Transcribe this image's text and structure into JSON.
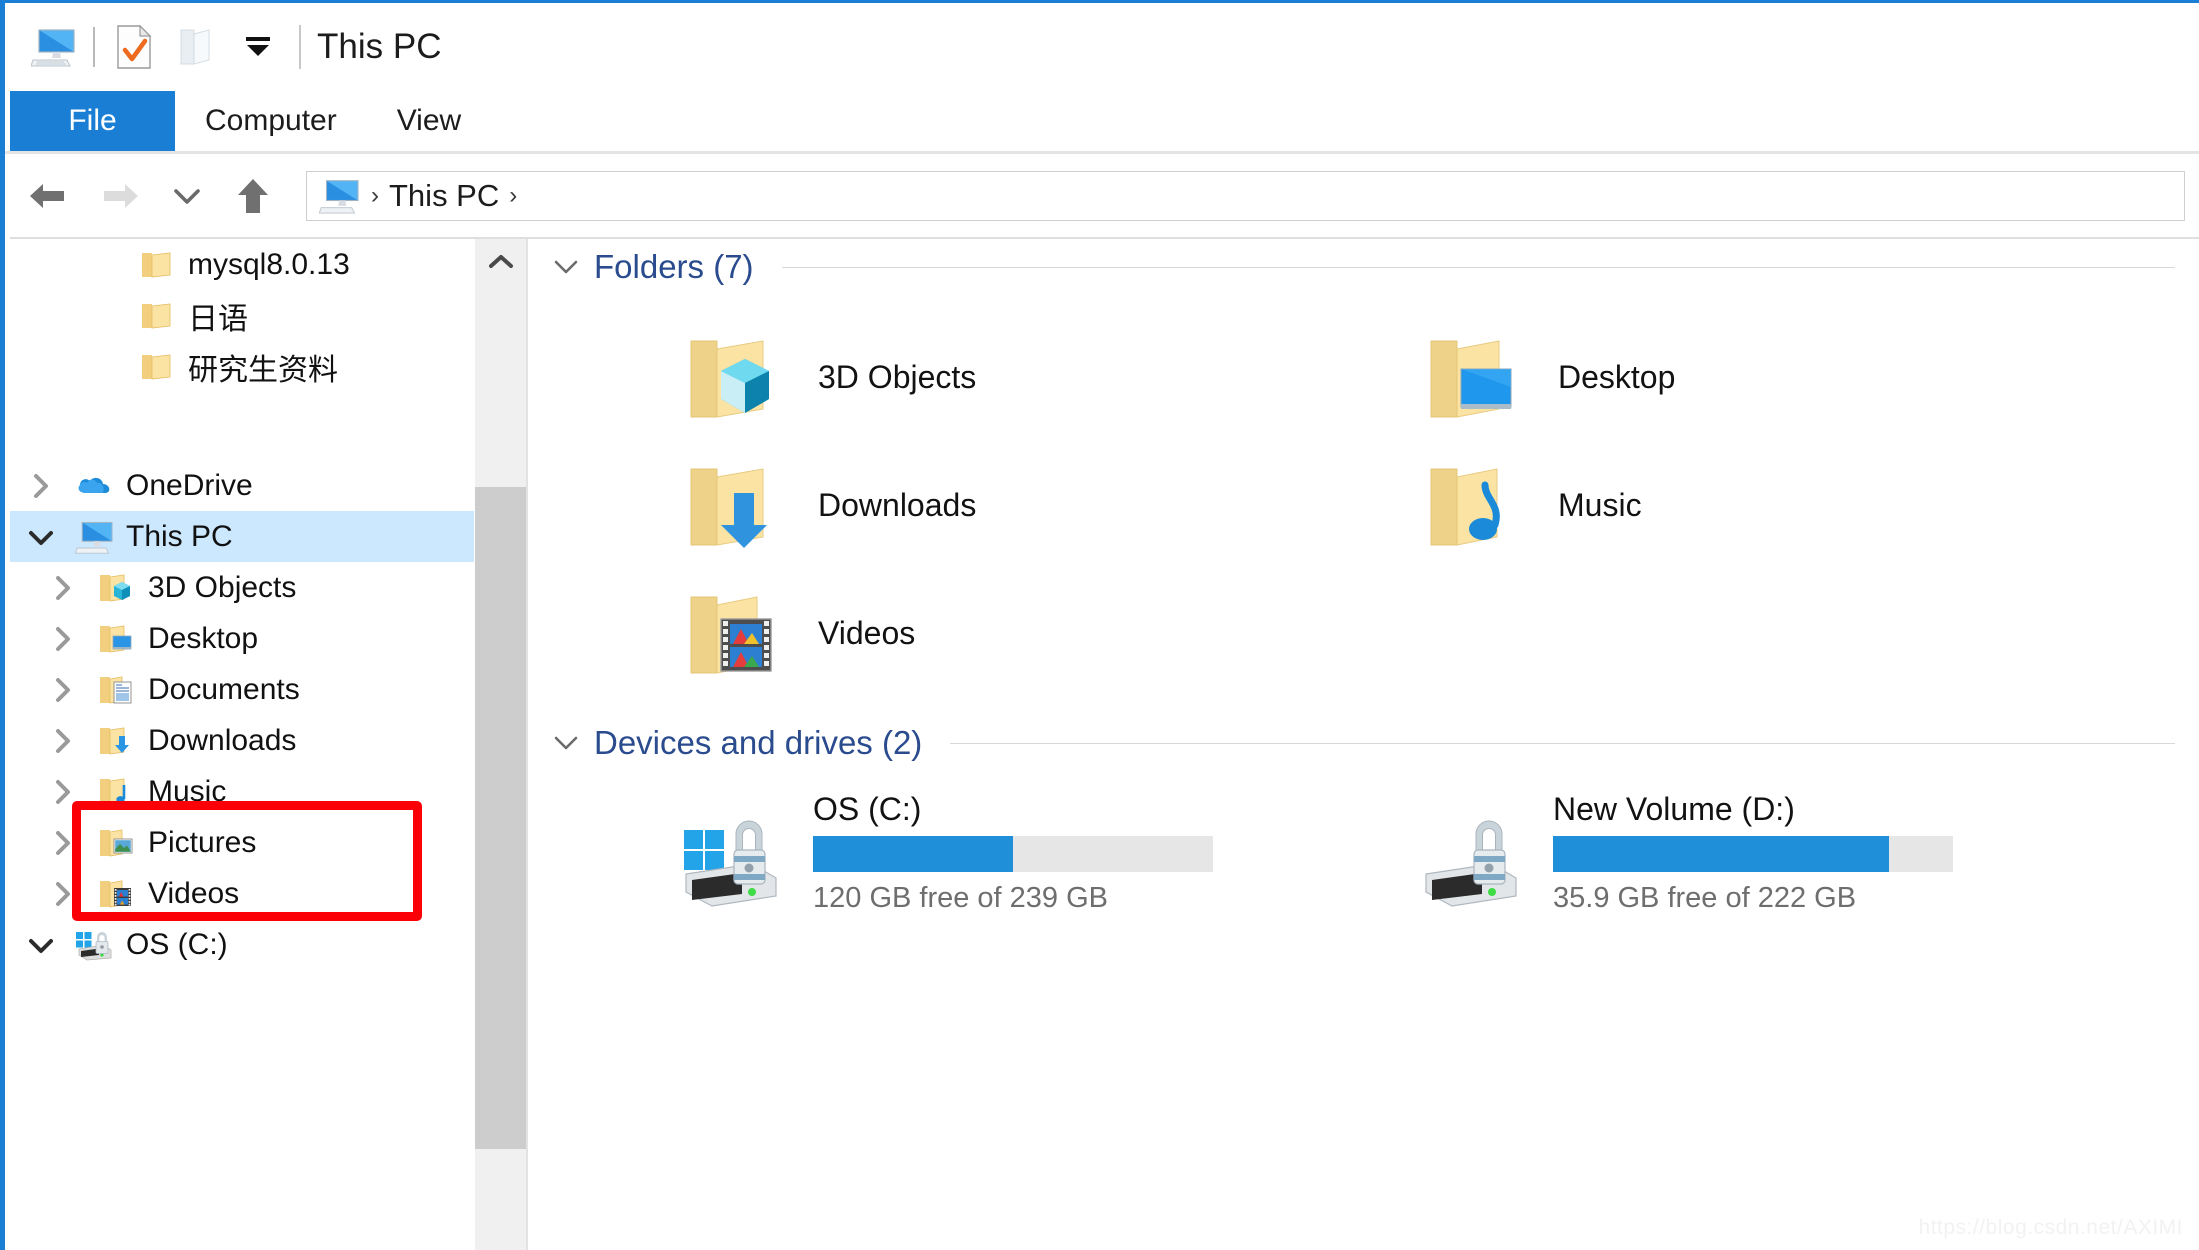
{
  "window": {
    "title": "This PC",
    "accent_color": "#1a7fd4",
    "quick_access": [
      {
        "name": "this-pc-icon",
        "label": "This PC"
      },
      {
        "name": "properties-icon",
        "label": "Properties"
      },
      {
        "name": "new-folder-icon",
        "label": "New folder"
      },
      {
        "name": "customize-dropdown-icon",
        "label": "Customize Quick Access Toolbar"
      }
    ]
  },
  "ribbon": {
    "tabs": [
      {
        "label": "File",
        "active": true
      },
      {
        "label": "Computer",
        "active": false
      },
      {
        "label": "View",
        "active": false
      }
    ]
  },
  "navbar": {
    "back_label": "Back",
    "forward_label": "Forward",
    "recent_label": "Recent locations",
    "up_label": "Up to Desktop",
    "breadcrumb": {
      "icon": "this-pc-icon",
      "items": [
        "This PC"
      ],
      "separator": "›"
    }
  },
  "sidebar": {
    "items": [
      {
        "label": "mysql8.0.13",
        "icon": "folder-icon",
        "chevron": "none",
        "indent": 2,
        "selected": false
      },
      {
        "label": "日语",
        "icon": "folder-icon",
        "chevron": "none",
        "indent": 2,
        "selected": false
      },
      {
        "label": "研究生资料",
        "icon": "folder-icon",
        "chevron": "none",
        "indent": 2,
        "selected": false
      },
      {
        "label": "",
        "icon": "spacer",
        "chevron": "none",
        "indent": 0,
        "selected": false
      },
      {
        "label": "OneDrive",
        "icon": "onedrive-cloud-icon",
        "chevron": "collapsed",
        "indent": 0,
        "selected": false
      },
      {
        "label": "This PC",
        "icon": "this-pc-icon",
        "chevron": "expanded",
        "indent": 0,
        "selected": true
      },
      {
        "label": "3D Objects",
        "icon": "folder-3d-objects-icon",
        "chevron": "collapsed",
        "indent": 1,
        "selected": false
      },
      {
        "label": "Desktop",
        "icon": "folder-desktop-icon",
        "chevron": "collapsed",
        "indent": 1,
        "selected": false
      },
      {
        "label": "Documents",
        "icon": "folder-documents-icon",
        "chevron": "collapsed",
        "indent": 1,
        "selected": false
      },
      {
        "label": "Downloads",
        "icon": "folder-downloads-icon",
        "chevron": "collapsed",
        "indent": 1,
        "selected": false
      },
      {
        "label": "Music",
        "icon": "folder-music-icon",
        "chevron": "collapsed",
        "indent": 1,
        "selected": false
      },
      {
        "label": "Pictures",
        "icon": "folder-pictures-icon",
        "chevron": "collapsed",
        "indent": 1,
        "selected": false
      },
      {
        "label": "Videos",
        "icon": "folder-videos-icon",
        "chevron": "collapsed",
        "indent": 1,
        "selected": false
      },
      {
        "label": "OS (C:)",
        "icon": "drive-os-icon",
        "chevron": "expanded",
        "indent": 1,
        "selected": false
      }
    ]
  },
  "content": {
    "folders_group": {
      "title": "Folders (7)",
      "chevron": "⌄",
      "items": [
        {
          "name": "3D Objects",
          "icon": "folder-3d-objects-icon"
        },
        {
          "name": "Desktop",
          "icon": "folder-desktop-icon"
        },
        {
          "name": "Downloads",
          "icon": "folder-downloads-icon"
        },
        {
          "name": "Music",
          "icon": "folder-music-icon"
        },
        {
          "name": "Videos",
          "icon": "folder-videos-icon"
        }
      ]
    },
    "drives_group": {
      "title": "Devices and drives (2)",
      "chevron": "⌄",
      "items": [
        {
          "name": "OS (C:)",
          "icon": "drive-windows-bitlocker-icon",
          "free_text": "120 GB free of 239 GB",
          "free_gb": 120,
          "total_gb": 239,
          "used_percent": 50,
          "bar_color": "#1e8fd8"
        },
        {
          "name": "New Volume (D:)",
          "icon": "drive-bitlocker-icon",
          "free_text": "35.9 GB free of 222 GB",
          "free_gb": 35.9,
          "total_gb": 222,
          "used_percent": 84,
          "bar_color": "#1e8fd8"
        }
      ]
    }
  },
  "annotation": {
    "color": "#fb0007",
    "target": "This PC"
  },
  "watermark": {
    "text": "https://blog.csdn.net/AXIMI"
  }
}
